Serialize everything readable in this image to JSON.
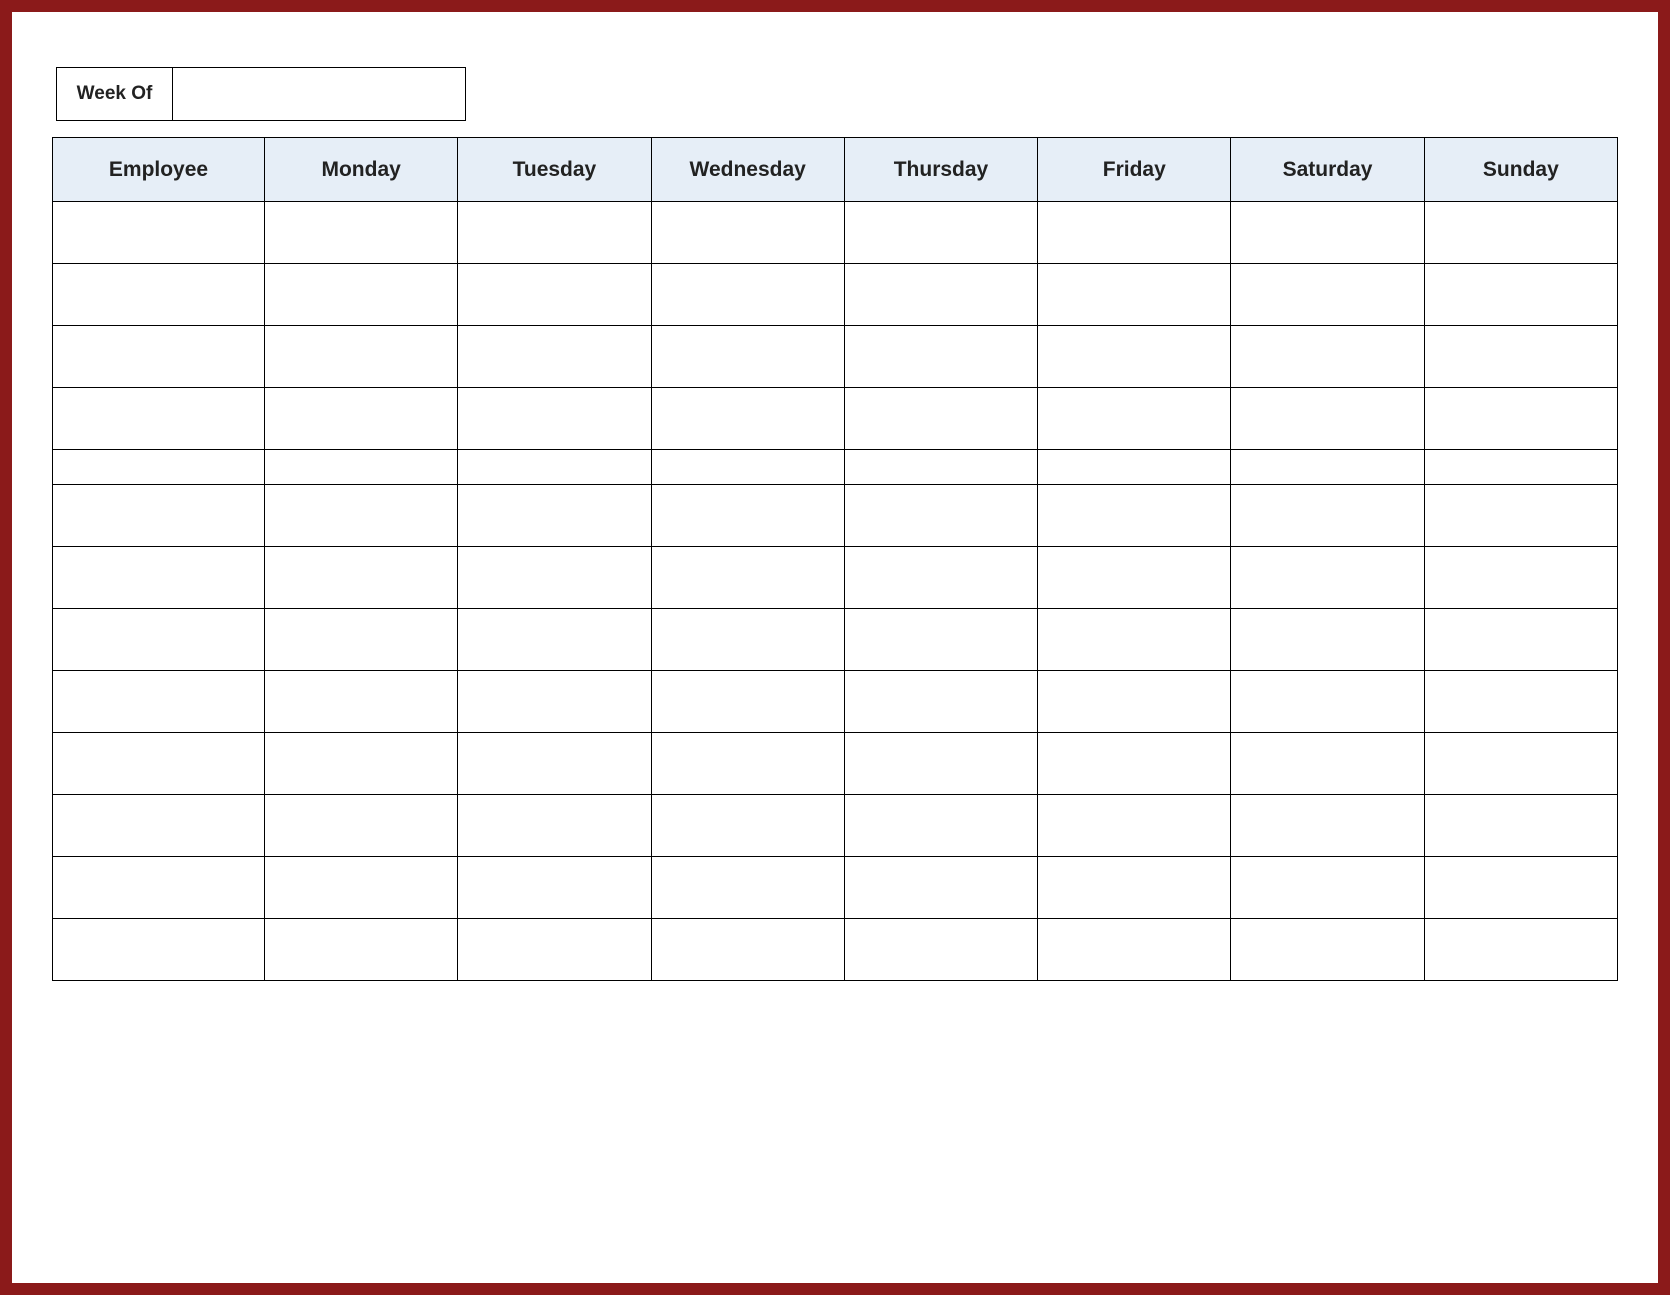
{
  "week_of": {
    "label": "Week Of",
    "value": ""
  },
  "columns": [
    "Employee",
    "Monday",
    "Tuesday",
    "Wednesday",
    "Thursday",
    "Friday",
    "Saturday",
    "Sunday"
  ],
  "rows": [
    {
      "employee": "",
      "monday": "",
      "tuesday": "",
      "wednesday": "",
      "thursday": "",
      "friday": "",
      "saturday": "",
      "sunday": ""
    },
    {
      "employee": "",
      "monday": "",
      "tuesday": "",
      "wednesday": "",
      "thursday": "",
      "friday": "",
      "saturday": "",
      "sunday": ""
    },
    {
      "employee": "",
      "monday": "",
      "tuesday": "",
      "wednesday": "",
      "thursday": "",
      "friday": "",
      "saturday": "",
      "sunday": ""
    },
    {
      "employee": "",
      "monday": "",
      "tuesday": "",
      "wednesday": "",
      "thursday": "",
      "friday": "",
      "saturday": "",
      "sunday": ""
    },
    {
      "employee": "",
      "monday": "",
      "tuesday": "",
      "wednesday": "",
      "thursday": "",
      "friday": "",
      "saturday": "",
      "sunday": ""
    },
    {
      "employee": "",
      "monday": "",
      "tuesday": "",
      "wednesday": "",
      "thursday": "",
      "friday": "",
      "saturday": "",
      "sunday": ""
    },
    {
      "employee": "",
      "monday": "",
      "tuesday": "",
      "wednesday": "",
      "thursday": "",
      "friday": "",
      "saturday": "",
      "sunday": ""
    },
    {
      "employee": "",
      "monday": "",
      "tuesday": "",
      "wednesday": "",
      "thursday": "",
      "friday": "",
      "saturday": "",
      "sunday": ""
    },
    {
      "employee": "",
      "monday": "",
      "tuesday": "",
      "wednesday": "",
      "thursday": "",
      "friday": "",
      "saturday": "",
      "sunday": ""
    },
    {
      "employee": "",
      "monday": "",
      "tuesday": "",
      "wednesday": "",
      "thursday": "",
      "friday": "",
      "saturday": "",
      "sunday": ""
    },
    {
      "employee": "",
      "monday": "",
      "tuesday": "",
      "wednesday": "",
      "thursday": "",
      "friday": "",
      "saturday": "",
      "sunday": ""
    },
    {
      "employee": "",
      "monday": "",
      "tuesday": "",
      "wednesday": "",
      "thursday": "",
      "friday": "",
      "saturday": "",
      "sunday": ""
    }
  ],
  "layout": {
    "spacer_after_row_index": 3
  }
}
